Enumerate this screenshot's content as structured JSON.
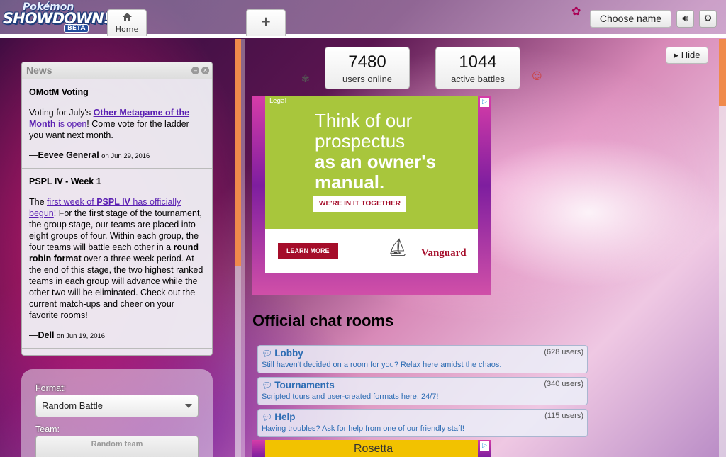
{
  "app": {
    "logo_top": "Pokémon",
    "logo_main": "SHOWDOWN!",
    "logo_badge": "BETA"
  },
  "tabs": {
    "home_label": "Home",
    "home_icon": "home-icon",
    "new_tab_label": "+"
  },
  "header": {
    "choose_name": "Choose name",
    "sound_icon": "speaker-icon",
    "settings_icon": "gear-icon"
  },
  "news": {
    "title": "News",
    "items": [
      {
        "heading": "OMotM Voting",
        "body_pre": "Voting for July's ",
        "link_bold": "Other Metagame of the Month",
        "link_rest": " is open",
        "body_post": "! Come vote for the ladder you want next month.",
        "author": "Eevee General",
        "date": "on Jun 29, 2016"
      },
      {
        "heading": "PSPL IV - Week 1",
        "body_pre": "The ",
        "link_plain": "first week of ",
        "link_bold": "PSPL IV",
        "link_rest": " has officially begun",
        "body_mid": "! For the first stage of the tournament, the group stage, our teams are placed into eight groups of four. Within each group, the four teams will battle each other in a ",
        "bold_text": "round robin format",
        "body_post": " over a three week period. At the end of this stage, the two highest ranked teams in each group will advance while the other two will be eliminated. Check out the current match-ups and cheer on your favorite rooms!",
        "author": "Dell",
        "date": "on Jun 19, 2016"
      }
    ]
  },
  "battle_form": {
    "format_label": "Format:",
    "format_value": "Random Battle",
    "team_label": "Team:",
    "team_value": "Random team"
  },
  "stats": {
    "users_online": "7480",
    "users_label": "users online",
    "active_battles": "1044",
    "battles_label": "active battles"
  },
  "hide_button": "Hide",
  "ad_top": {
    "legal": "Legal",
    "line1": "Think of our",
    "line2": "prospectus",
    "line3": "as an owner's",
    "line4": "manual.",
    "cta": "WE'RE IN IT TOGETHER",
    "learn_more": "LEARN MORE",
    "brand": "Vanguard"
  },
  "chat": {
    "title": "Official chat rooms",
    "rooms": [
      {
        "name": "Lobby",
        "count": "(628 users)",
        "desc": "Still haven't decided on a room for you? Relax here amidst the chaos."
      },
      {
        "name": "Tournaments",
        "count": "(340 users)",
        "desc": "Scripted tours and user-created formats here, 24/7!"
      },
      {
        "name": "Help",
        "count": "(115 users)",
        "desc": "Having troubles? Ask for help from one of our friendly staff!"
      }
    ]
  },
  "ad_bottom": {
    "text": "Rosetta"
  },
  "colors": {
    "accent_scrollbar": "#f08a4b",
    "link_purple": "#5a1fb2",
    "room_blue": "#2e6db4",
    "ad_red": "#a50d2a",
    "ad_green": "#a8c63c"
  }
}
